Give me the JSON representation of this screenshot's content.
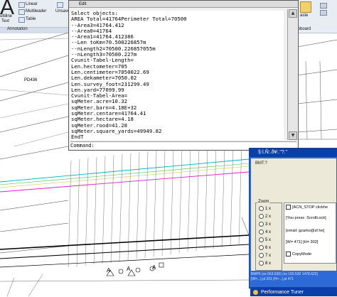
{
  "ribbon": {
    "big_letter": "A",
    "multiline_label": "ultiline",
    "text_label": "Text",
    "linear_label": "Linear",
    "multileader_label": "Multileader",
    "table_label": "Table",
    "unsave_label": "Unsave",
    "annotation_panel": "Annotation",
    "clipboard_panel": "lipboard",
    "paste_label": "aste"
  },
  "drawing": {
    "labels": [
      "PD436",
      "A",
      "A",
      "A"
    ]
  },
  "text_window": {
    "title": "Edit",
    "lines": [
      "Select objects:",
      "AREA Total=41764Perimeter Total=70500",
      "--Area3=41764.412",
      "--Area0=41764",
      "--Area1=41764.412386",
      "--Len toKm=70.500226857m",
      "--nLength2=70500.226857055m",
      "--nLength3=70500.227m",
      "Cvunit-Tabel-Length=",
      "Len.hectometer=705",
      "Len.centimeter=7050022.69",
      "Len.dekameter=7050.02",
      "Len.survey_foot=231299.49",
      "Len.yard=77099.99",
      "Cvunit-Tabel-Area=",
      "sqMeter.acre=10.32",
      "sqMeter.barn=4.18E+32",
      "sqMeter.centare=41764.41",
      "sqMeter.hectare=4.18",
      "sqMeter.rood=41.28",
      "sqMeter.square_yards=49949.82",
      "EndT"
    ],
    "command_prompt": "Command:"
  },
  "zoom_window": {
    "title": "§:İ.Ñ:.ð¥:.\"?.\"",
    "menu": "BMT.?",
    "group_title": "Zoom",
    "options": [
      "1 x",
      "2 x",
      "3 x",
      "4 x",
      "5 x",
      "6 x",
      "7 x",
      "8 x"
    ],
    "info_lines": [
      "[ACN_STOP clickhe",
      "[You press :ScrollLock]",
      "[email: gzarko@sf.he]",
      "[W= 471] [H= 302]",
      "CopyMode"
    ],
    "status_line1": "BMP6 (xs 663.530) (xx 100.520 1478.622)",
    "status_line2": "[W=...] pt 201 [H=...] pt 471"
  },
  "perf_tuner": {
    "title": "Performance Tuner"
  }
}
